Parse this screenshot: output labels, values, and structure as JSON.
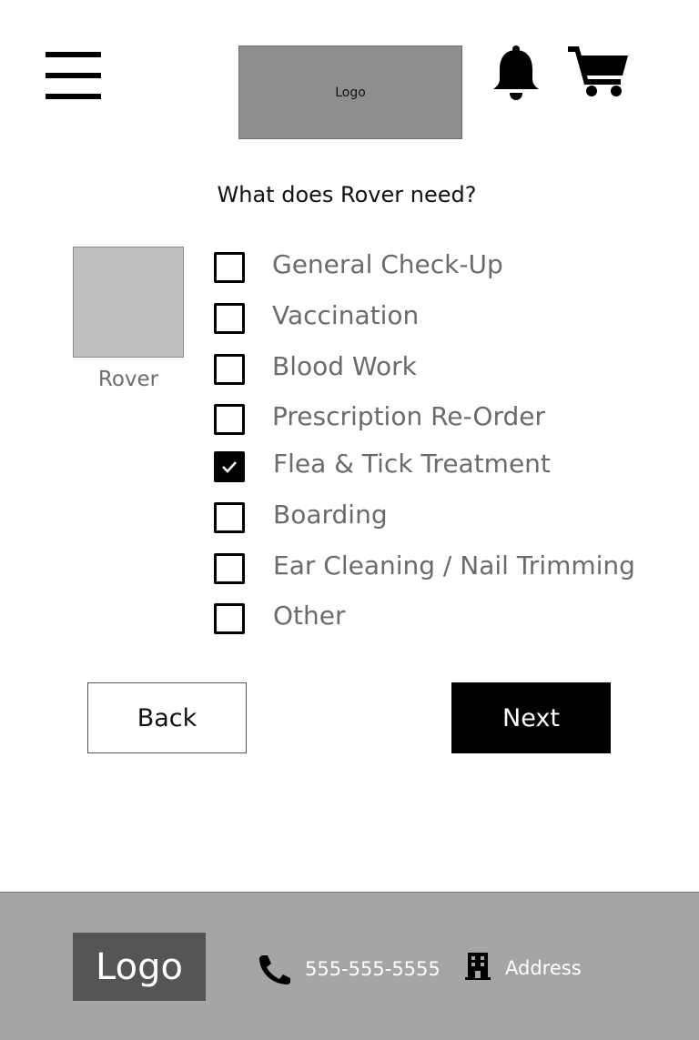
{
  "header": {
    "logo_text": "Logo",
    "icons": [
      "menu-icon",
      "bell-icon",
      "cart-icon"
    ]
  },
  "main": {
    "question": "What does Rover need?",
    "pet": {
      "name": "Rover"
    },
    "options": [
      {
        "label": "General Check-Up",
        "checked": false
      },
      {
        "label": "Vaccination",
        "checked": false
      },
      {
        "label": "Blood Work",
        "checked": false
      },
      {
        "label": "Prescription Re-Order",
        "checked": false
      },
      {
        "label": "Flea & Tick Treatment",
        "checked": true
      },
      {
        "label": "Boarding",
        "checked": false
      },
      {
        "label": "Ear Cleaning / Nail Trimming",
        "checked": false
      },
      {
        "label": "Other",
        "checked": false
      }
    ]
  },
  "actions": {
    "back_label": "Back",
    "next_label": "Next"
  },
  "footer": {
    "logo_text": "Logo",
    "phone": "555-555-5555",
    "address": "Address",
    "icons": [
      "phone-icon",
      "building-icon"
    ]
  },
  "colors": {
    "header_logo_bg": "#8e8e8e",
    "footer_bg": "#a5a5a5",
    "footer_logo_bg": "#555555",
    "option_text": "#6b6b6b",
    "primary_button": "#000000"
  }
}
